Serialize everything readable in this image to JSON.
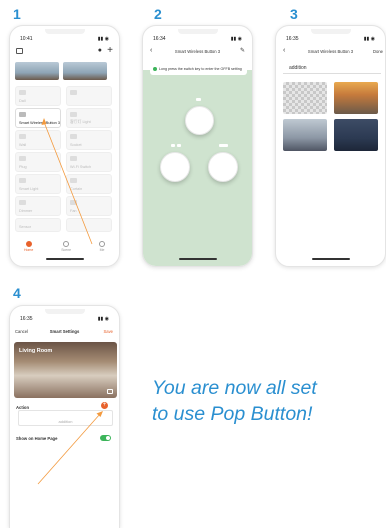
{
  "steps": [
    "1",
    "2",
    "3",
    "4"
  ],
  "colors": {
    "accent": "#2a8fd0",
    "orange": "#e8622c",
    "green": "#cfe3cf",
    "toggle": "#3cb45a"
  },
  "phone1": {
    "time": "10:41",
    "tiles": [
      {
        "label": "Dall",
        "active": false
      },
      {
        "label": "Smart Wireless Button 3",
        "active": true
      },
      {
        "label": "客厅灯 Light",
        "active": false
      },
      {
        "label": "Wall",
        "active": false
      },
      {
        "label": "Socket",
        "active": false
      },
      {
        "label": "Plug",
        "active": false
      },
      {
        "label": "Wi-Fi Switch",
        "active": false
      },
      {
        "label": "Smart Light",
        "active": false
      },
      {
        "label": "Curtain",
        "active": false
      },
      {
        "label": "Dimmer",
        "active": false
      },
      {
        "label": "Fan",
        "active": false
      },
      {
        "label": "Sensor",
        "active": false
      }
    ],
    "tabs": [
      "Home",
      "Scene",
      "Me"
    ]
  },
  "phone2": {
    "time": "16:34",
    "title": "Smart Wireless Button 3",
    "hint": "Long press the switch key to enter the OFFB setting"
  },
  "phone3": {
    "time": "16:35",
    "title": "Smart Wireless Button 3",
    "done": "Done",
    "search_value": "addition"
  },
  "phone4": {
    "time": "16:35",
    "cancel": "Cancel",
    "title": "Smart Settings",
    "save": "Save",
    "room_label": "Living Room",
    "action_label": "Action",
    "field_placeholder": "addition",
    "show_home": "Show on Home Page"
  },
  "message": {
    "line1": "You are now all set",
    "line2": "to use Pop Button!"
  }
}
